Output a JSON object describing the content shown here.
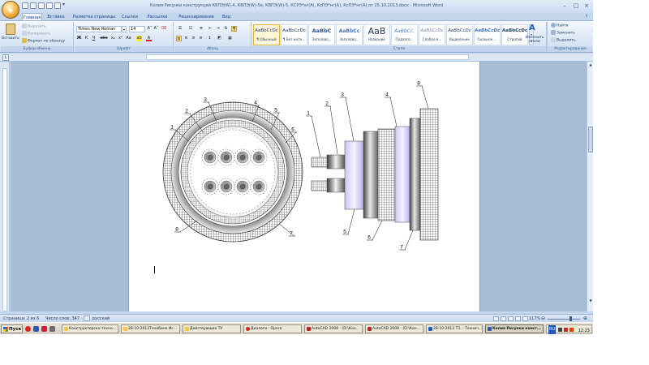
{
  "window": {
    "title": "Копия Рисунки  конструкций КВПЭ(W)-4, КВПЭ(W)-5е, КВПЭ(W)-5, КСРЭ*нг(A), КсПЭ*нг(A), КсПЭ*нг(A) от 25.10.2013.docx - Microsoft Word",
    "minimize": "–",
    "maximize": "□",
    "close": "×"
  },
  "tabs": [
    "Главная",
    "Вставка",
    "Разметка страницы",
    "Ссылки",
    "Рассылки",
    "Рецензирование",
    "Вид"
  ],
  "clipboard": {
    "paste": "Вставить",
    "cut": "Вырезать",
    "copy": "Копировать",
    "format_painter": "Формат по образцу",
    "label": "Буфер обмена"
  },
  "font": {
    "name": "Times New Roman",
    "size": "14",
    "grow": "A˄",
    "shrink": "A˅",
    "bold": "Ж",
    "italic": "К",
    "underline": "Ч",
    "strike": "abe",
    "sub": "x₂",
    "sup": "x²",
    "case": "Aa",
    "label": "Шрифт"
  },
  "paragraph": {
    "label": "Абзац",
    "marks": "¶"
  },
  "styles": {
    "label": "Стили",
    "items": [
      {
        "sample": "AaBbCcDc",
        "name": "¶ Обычный"
      },
      {
        "sample": "AaBbCcDc",
        "name": "¶ Без инте..."
      },
      {
        "sample": "AaBbC",
        "name": "Заголово..."
      },
      {
        "sample": "AaBbCc",
        "name": "Заголово..."
      },
      {
        "sample": "AaB",
        "name": "Название"
      },
      {
        "sample": "AaBbCc.",
        "name": "Подзаго..."
      },
      {
        "sample": "AaBbCcDc",
        "name": "Слабое в..."
      },
      {
        "sample": "AaBbCcDc",
        "name": "Выделение"
      },
      {
        "sample": "AaBbCcDc",
        "name": "Сильное ..."
      },
      {
        "sample": "AaBbCcDc",
        "name": "Строгий"
      }
    ],
    "change": "Изменить стили"
  },
  "editing": {
    "find": "Найти",
    "replace": "Заменить",
    "select": "Выделить",
    "label": "Редактирование"
  },
  "drawing": {
    "left_labels": [
      "1",
      "2",
      "3",
      "4",
      "5",
      "6",
      "7",
      "8"
    ],
    "right_labels": [
      "1",
      "2",
      "3",
      "4",
      "5",
      "6",
      "7",
      "8"
    ]
  },
  "status": {
    "page": "Страница: 2 из 6",
    "words": "Число слов: 347",
    "language": "русский",
    "zoom": "117%"
  },
  "taskbar": {
    "start": "Пуск",
    "lang": "RU",
    "items": [
      "Конструкторско-техно...",
      "28-10-2013Техобинк Ис...",
      "Действующие ТУ",
      "Диалоги - Opera",
      "AutoCAD 2008 - [D:\\Кон...",
      "AutoCAD 2008 - [D:\\Кон...",
      "28-10-2013 ТЗ. - Технич...",
      "Копия Рисунки конст..."
    ],
    "clock": "12:23"
  },
  "colors": {
    "ribbon": "#dbe7f5",
    "accent": "#15428b",
    "workspace": "#a9bcd6"
  }
}
